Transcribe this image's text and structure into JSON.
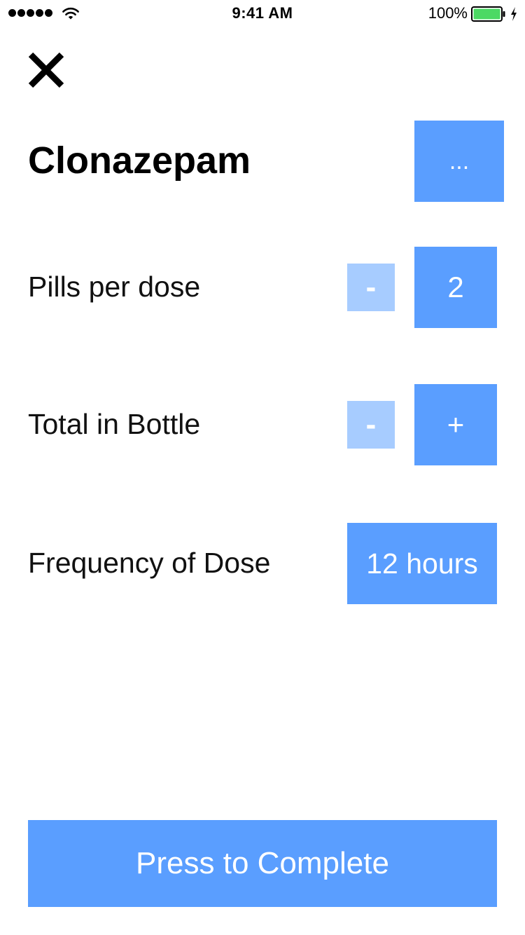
{
  "status_bar": {
    "time": "9:41 AM",
    "battery_percent": "100%",
    "signal_icon": "signal-dots-icon",
    "wifi_icon": "wifi-icon",
    "battery_icon": "battery-icon",
    "charging_icon": "bolt-icon",
    "battery_color": "#4cd964"
  },
  "header": {
    "close_icon": "close-icon",
    "medication_name": "Clonazepam",
    "more_label": "..."
  },
  "rows": {
    "pills_per_dose": {
      "label": "Pills per dose",
      "decrement_label": "-",
      "value": "2"
    },
    "total_in_bottle": {
      "label": "Total in Bottle",
      "decrement_label": "-",
      "increment_label": "+"
    },
    "frequency": {
      "label": "Frequency of Dose",
      "value": "12 hours"
    }
  },
  "footer": {
    "complete_label": "Press to Complete"
  },
  "colors": {
    "accent": "#5a9eff",
    "accent_faded": "#a7ccff",
    "background": "#ffffff",
    "text": "#000000"
  }
}
